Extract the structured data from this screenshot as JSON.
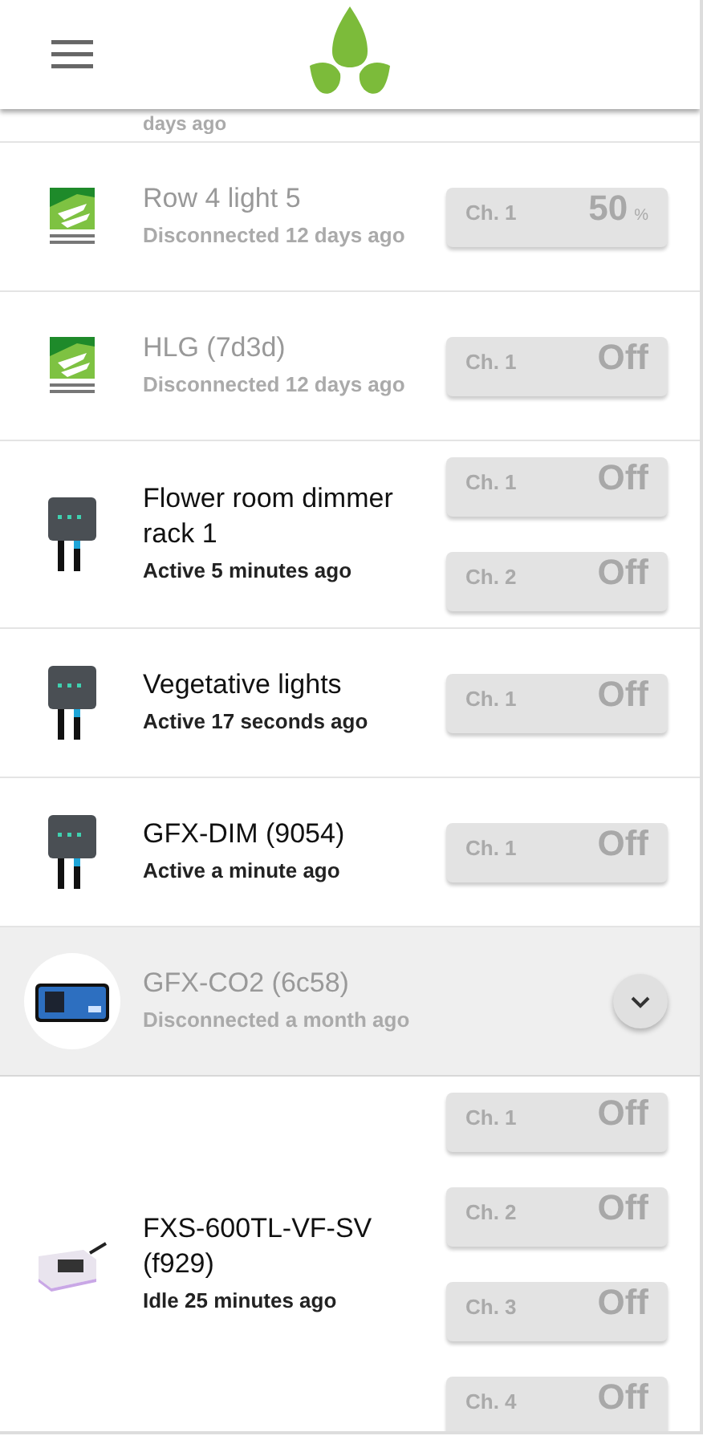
{
  "partial_row": {
    "status": "days ago"
  },
  "devices": [
    {
      "name": "Row 4 light 5",
      "status": "Disconnected 12 days ago",
      "connected": false,
      "selected": false,
      "kind": "hlg",
      "channels": [
        {
          "label": "Ch. 1",
          "value": "50",
          "unit": "%"
        }
      ]
    },
    {
      "name": "HLG (7d3d)",
      "status": "Disconnected 12 days ago",
      "connected": false,
      "selected": false,
      "kind": "hlg",
      "channels": [
        {
          "label": "Ch. 1",
          "value": "Off"
        }
      ]
    },
    {
      "name": "Flower room dimmer rack 1",
      "status": "Active 5 minutes ago",
      "connected": true,
      "selected": false,
      "kind": "dimmer",
      "channels": [
        {
          "label": "Ch. 1",
          "value": "Off"
        },
        {
          "label": "Ch. 2",
          "value": "Off"
        }
      ]
    },
    {
      "name": "Vegetative lights",
      "status": "Active 17 seconds ago",
      "connected": true,
      "selected": false,
      "kind": "dimmer",
      "channels": [
        {
          "label": "Ch. 1",
          "value": "Off"
        }
      ]
    },
    {
      "name": "GFX-DIM (9054)",
      "status": "Active a minute ago",
      "connected": true,
      "selected": false,
      "kind": "dimmer",
      "channels": [
        {
          "label": "Ch. 1",
          "value": "Off"
        }
      ]
    },
    {
      "name": "GFX-CO2 (6c58)",
      "status": "Disconnected a month ago",
      "connected": false,
      "selected": true,
      "kind": "co2"
    },
    {
      "name": "FXS-600TL-VF-SV (f929)",
      "status": "Idle 25 minutes ago",
      "connected": true,
      "selected": false,
      "kind": "fixture",
      "channels": [
        {
          "label": "Ch. 1",
          "value": "Off"
        },
        {
          "label": "Ch. 2",
          "value": "Off"
        },
        {
          "label": "Ch. 3",
          "value": "Off"
        },
        {
          "label": "Ch. 4",
          "value": "Off"
        }
      ]
    }
  ]
}
